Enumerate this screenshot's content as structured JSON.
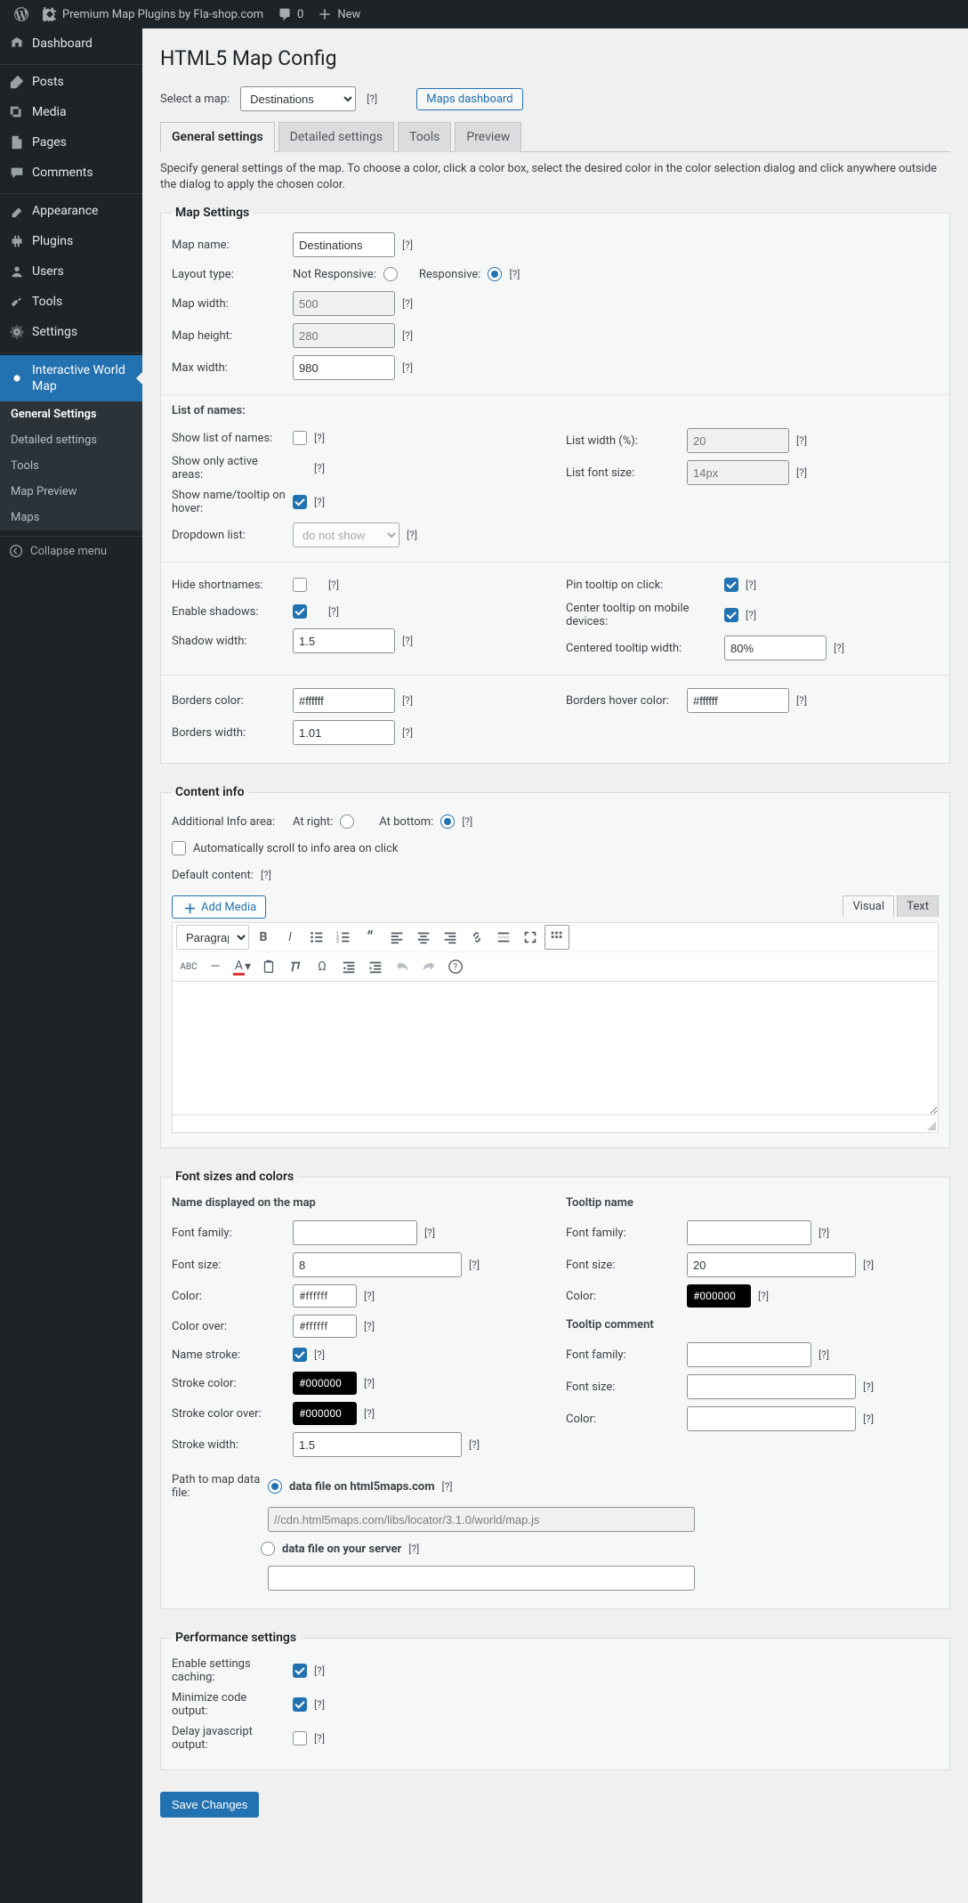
{
  "adminbar": {
    "site_title": "Premium Map Plugins by Fla-shop.com",
    "comments": "0",
    "new_label": "New"
  },
  "sidebar": {
    "items": [
      {
        "label": "Dashboard",
        "icon": "dashboard"
      },
      {
        "label": "Posts",
        "icon": "pin"
      },
      {
        "label": "Media",
        "icon": "media"
      },
      {
        "label": "Pages",
        "icon": "page"
      },
      {
        "label": "Comments",
        "icon": "comment"
      },
      {
        "label": "Appearance",
        "icon": "brush"
      },
      {
        "label": "Plugins",
        "icon": "plug"
      },
      {
        "label": "Users",
        "icon": "users"
      },
      {
        "label": "Tools",
        "icon": "tool"
      },
      {
        "label": "Settings",
        "icon": "gear"
      },
      {
        "label": "Interactive World Map",
        "icon": "gear"
      }
    ],
    "submenu": [
      "General Settings",
      "Detailed settings",
      "Tools",
      "Map Preview",
      "Maps"
    ],
    "collapse": "Collapse menu"
  },
  "page": {
    "title": "HTML5 Map Config",
    "select_label": "Select a map:",
    "select_value": "Destinations",
    "maps_dashboard": "Maps dashboard",
    "tabs": [
      "General settings",
      "Detailed settings",
      "Tools",
      "Preview"
    ],
    "description": "Specify general settings of the map. To choose a color, click a color box, select the desired color in the color selection dialog and click anywhere outside the dialog to apply the chosen color."
  },
  "map_settings": {
    "legend": "Map Settings",
    "map_name_label": "Map name:",
    "map_name": "Destinations",
    "layout_type_label": "Layout type:",
    "layout_not_responsive": "Not Responsive:",
    "layout_responsive": "Responsive:",
    "map_width_label": "Map width:",
    "map_width_ph": "500",
    "map_height_label": "Map height:",
    "map_height_ph": "280",
    "max_width_label": "Max width:",
    "max_width": "980",
    "list_of_names": "List of names:",
    "show_list_label": "Show list of names:",
    "show_active_label": "Show only active areas:",
    "show_hover_label": "Show name/tooltip on hover:",
    "dropdown_label": "Dropdown list:",
    "dropdown_value": "do not show",
    "list_width_label": "List width (%):",
    "list_width_ph": "20",
    "list_font_label": "List font size:",
    "list_font_ph": "14px",
    "hide_short_label": "Hide shortnames:",
    "enable_shadows_label": "Enable shadows:",
    "shadow_width_label": "Shadow width:",
    "shadow_width": "1.5",
    "pin_tooltip_label": "Pin tooltip on click:",
    "center_tooltip_label": "Center tooltip on mobile devices:",
    "centered_width_label": "Centered tooltip width:",
    "centered_width": "80%",
    "borders_color_label": "Borders color:",
    "borders_color": "#ffffff",
    "borders_hover_label": "Borders hover color:",
    "borders_hover": "#ffffff",
    "borders_width_label": "Borders width:",
    "borders_width": "1.01"
  },
  "content_info": {
    "legend": "Content info",
    "additional_label": "Additional Info area:",
    "at_right": "At right:",
    "at_bottom": "At bottom:",
    "auto_scroll": "Automatically scroll to info area on click",
    "default_content": "Default content:",
    "add_media": "Add Media",
    "visual": "Visual",
    "text": "Text",
    "paragraph": "Paragraph"
  },
  "fonts": {
    "legend": "Font sizes and colors",
    "name_section": "Name displayed on the map",
    "tooltip_name": "Tooltip name",
    "tooltip_comment": "Tooltip comment",
    "font_family": "Font family:",
    "font_size": "Font size:",
    "color_label": "Color:",
    "color_over_label": "Color over:",
    "name_stroke_label": "Name stroke:",
    "stroke_color_label": "Stroke color:",
    "stroke_color_over_label": "Stroke color over:",
    "stroke_width_label": "Stroke width:",
    "name_font_size": "8",
    "name_color": "#ffffff",
    "name_color_over": "#ffffff",
    "stroke_color": "#000000",
    "stroke_color_over": "#000000",
    "stroke_width": "1.5",
    "tooltip_name_font_size": "20",
    "tooltip_name_color": "#000000",
    "path_label": "Path to map data file:",
    "data_file_cdn": "data file on html5maps.com",
    "cdn_path": "//cdn.html5maps.com/libs/locator/3.1.0/world/map.js",
    "data_file_local": "data file on your server"
  },
  "perf": {
    "legend": "Performance settings",
    "caching_label": "Enable settings caching:",
    "minimize_label": "Minimize code output:",
    "delay_label": "Delay javascript output:"
  },
  "save": "Save Changes",
  "help": "[?]"
}
